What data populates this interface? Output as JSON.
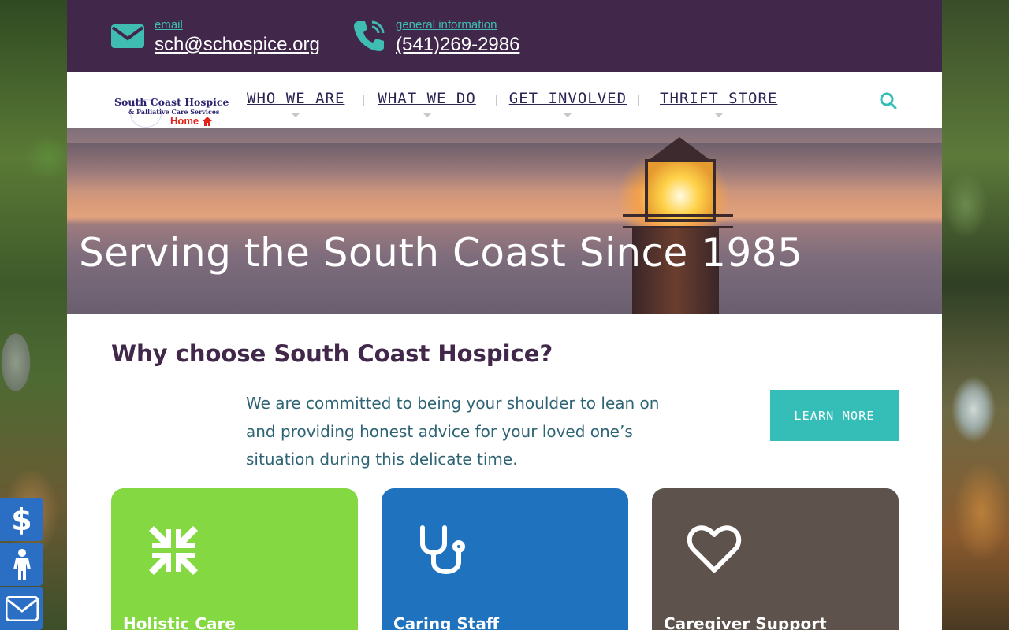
{
  "topbar": {
    "email": {
      "label": "email",
      "value": "sch@schospice.org",
      "icon": "envelope-icon"
    },
    "phone": {
      "label": "general information",
      "value": "(541)269-2986",
      "icon": "phone-icon"
    }
  },
  "logo": {
    "line1": "South Coast Hospice",
    "line2": "& Palliative Care Services",
    "line3": "Home"
  },
  "nav": {
    "items": [
      {
        "label": "WHO WE ARE"
      },
      {
        "label": "WHAT WE DO"
      },
      {
        "label": "GET INVOLVED"
      },
      {
        "label": "THRIFT STORE"
      }
    ],
    "search_icon": "search-icon"
  },
  "hero": {
    "title": "Serving the South Coast Since 1985"
  },
  "content": {
    "heading": "Why choose South Coast Hospice?",
    "intro": "We are committed to being your shoulder to lean on and providing honest advice for your loved one’s situation during this delicate time.",
    "learn_more": "LEARN MORE"
  },
  "cards": [
    {
      "title": "Holistic Care",
      "icon": "compress-arrows-icon",
      "color": "#84d942"
    },
    {
      "title": "Caring Staff",
      "icon": "stethoscope-icon",
      "color": "#1f72bd"
    },
    {
      "title": "Caregiver Support",
      "icon": "heart-icon",
      "color": "#5d524c"
    }
  ],
  "side_buttons": [
    {
      "icon": "dollar-icon",
      "glyph": "$"
    },
    {
      "icon": "person-icon"
    },
    {
      "icon": "envelope-icon"
    }
  ],
  "colors": {
    "topbar": "#41284b",
    "accent": "#34beb7",
    "nav_text": "#2e2454",
    "intro_text": "#2f6474",
    "side_button": "#2a6fc4"
  }
}
